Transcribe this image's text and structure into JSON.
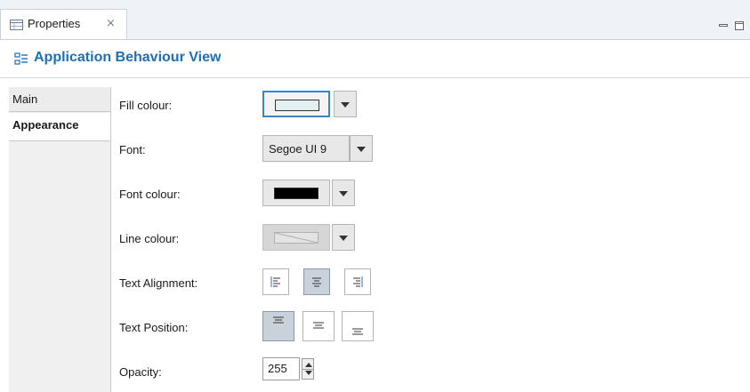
{
  "tab": {
    "title": "Properties",
    "close_glyph": "⨯"
  },
  "header": {
    "title": "Application Behaviour View"
  },
  "categories": [
    {
      "label": "Main"
    },
    {
      "label": "Appearance"
    }
  ],
  "form": {
    "fill_colour": {
      "label": "Fill colour:",
      "color": "#e2f1ef"
    },
    "font": {
      "label": "Font:",
      "value": "Segoe UI 9"
    },
    "font_colour": {
      "label": "Font colour:",
      "color": "#000000"
    },
    "line_colour": {
      "label": "Line colour:",
      "disabled": true
    },
    "text_alignment": {
      "label": "Text Alignment:",
      "options": [
        "left",
        "center",
        "right"
      ],
      "selected": "center"
    },
    "text_position": {
      "label": "Text Position:",
      "options": [
        "top",
        "middle",
        "bottom"
      ],
      "selected": "top"
    },
    "opacity": {
      "label": "Opacity:",
      "value": "255"
    }
  },
  "colors": {
    "accent": "#1f6fb5",
    "focus": "#3c84c8"
  }
}
